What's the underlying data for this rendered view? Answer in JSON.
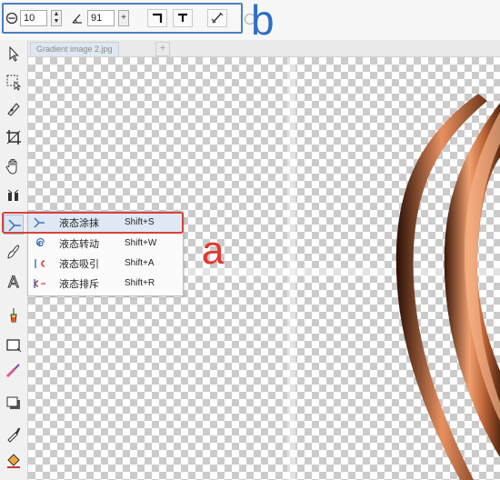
{
  "property_bar": {
    "tip_size_value": "10",
    "angle_value": "91",
    "label_b": "b",
    "icons": [
      "tip-size-icon",
      "angle-icon",
      "pressure-icon",
      "corner-left-icon",
      "corner-right-icon",
      "pen-pressure-icon"
    ]
  },
  "document": {
    "tab_label": "Gradient image 2.jpg",
    "add_tab": "+"
  },
  "flyout": {
    "items": [
      {
        "label": "液态涂抹",
        "shortcut": "Shift+S",
        "icon": "smear-icon",
        "selected": true
      },
      {
        "label": "液态转动",
        "shortcut": "Shift+W",
        "icon": "twirl-icon",
        "selected": false
      },
      {
        "label": "液态吸引",
        "shortcut": "Shift+A",
        "icon": "attract-icon",
        "selected": false
      },
      {
        "label": "液态排斥",
        "shortcut": "Shift+R",
        "icon": "repel-icon",
        "selected": false
      }
    ],
    "label_a": "a"
  },
  "toolbox": {
    "tools": [
      "pointer-tool",
      "transform-tool",
      "shape-edit-tool",
      "crop-tool",
      "hand-tool",
      "effects-tool",
      "liquid-smear-tool",
      "brush-tool",
      "text-tool",
      "color-pick-tool",
      "rectangle-tool",
      "paint-tool",
      "shadow-tool",
      "eyedropper-tool",
      "fill-tool"
    ]
  },
  "colors": {
    "callout_red": "#d9413a",
    "callout_blue": "#2f6fc4",
    "copper_dark": "#5a2a10",
    "copper_light": "#f0a070"
  }
}
